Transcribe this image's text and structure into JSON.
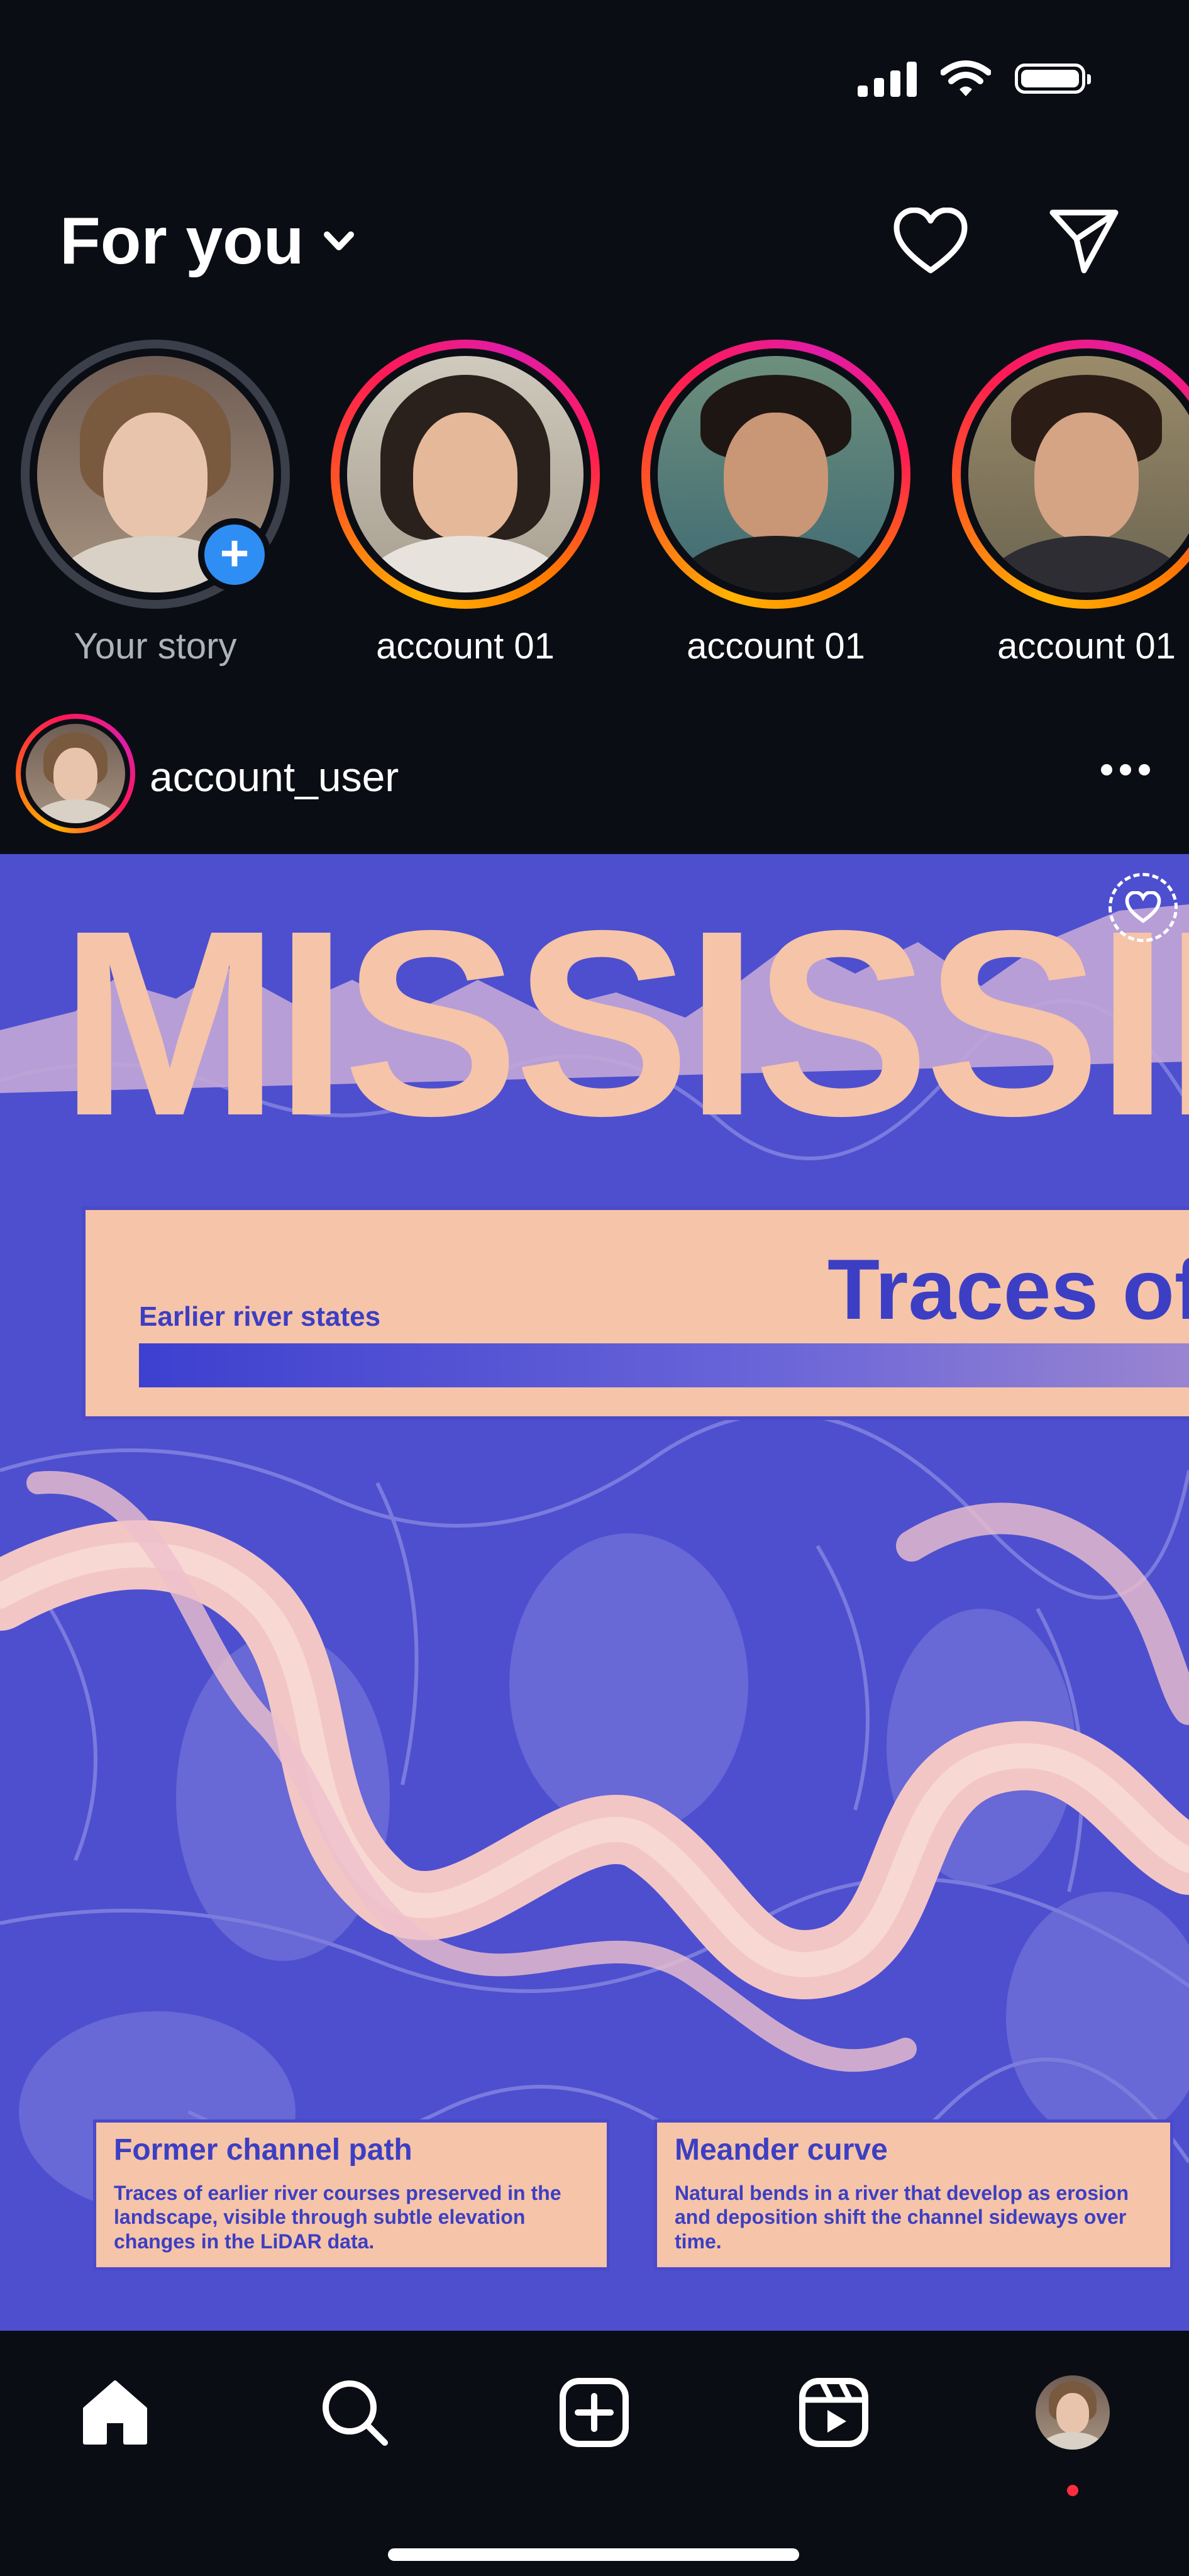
{
  "status_bar": {
    "icons": [
      "signal-icon",
      "wifi-icon",
      "battery-icon"
    ]
  },
  "header": {
    "title": "For you",
    "icons": [
      "chevron-down-icon",
      "heart-icon",
      "send-icon"
    ]
  },
  "stories": [
    {
      "label": "Your story",
      "own": true
    },
    {
      "label": "account 01"
    },
    {
      "label": "account 01"
    },
    {
      "label": "account 01"
    }
  ],
  "post": {
    "username": "account_user",
    "image": {
      "headline": "MISSISSIP",
      "banner_title": "Traces of",
      "banner_subtitle": "Earlier river states",
      "cards": [
        {
          "title": "Former channel path",
          "text": "Traces of earlier river courses preserved in the landscape, visible through subtle elevation changes in the LiDAR data."
        },
        {
          "title": "Meander curve",
          "text": "Natural bends in a river that develop as erosion and deposition shift the channel sideways over time."
        }
      ],
      "colors": {
        "background": "#4d4fcf",
        "accent": "#f6c4a8",
        "text": "#3c3fc4"
      }
    }
  },
  "bottom_nav": {
    "items": [
      "home-icon",
      "search-icon",
      "create-icon",
      "reels-icon",
      "profile-avatar"
    ],
    "active": "home-icon"
  }
}
